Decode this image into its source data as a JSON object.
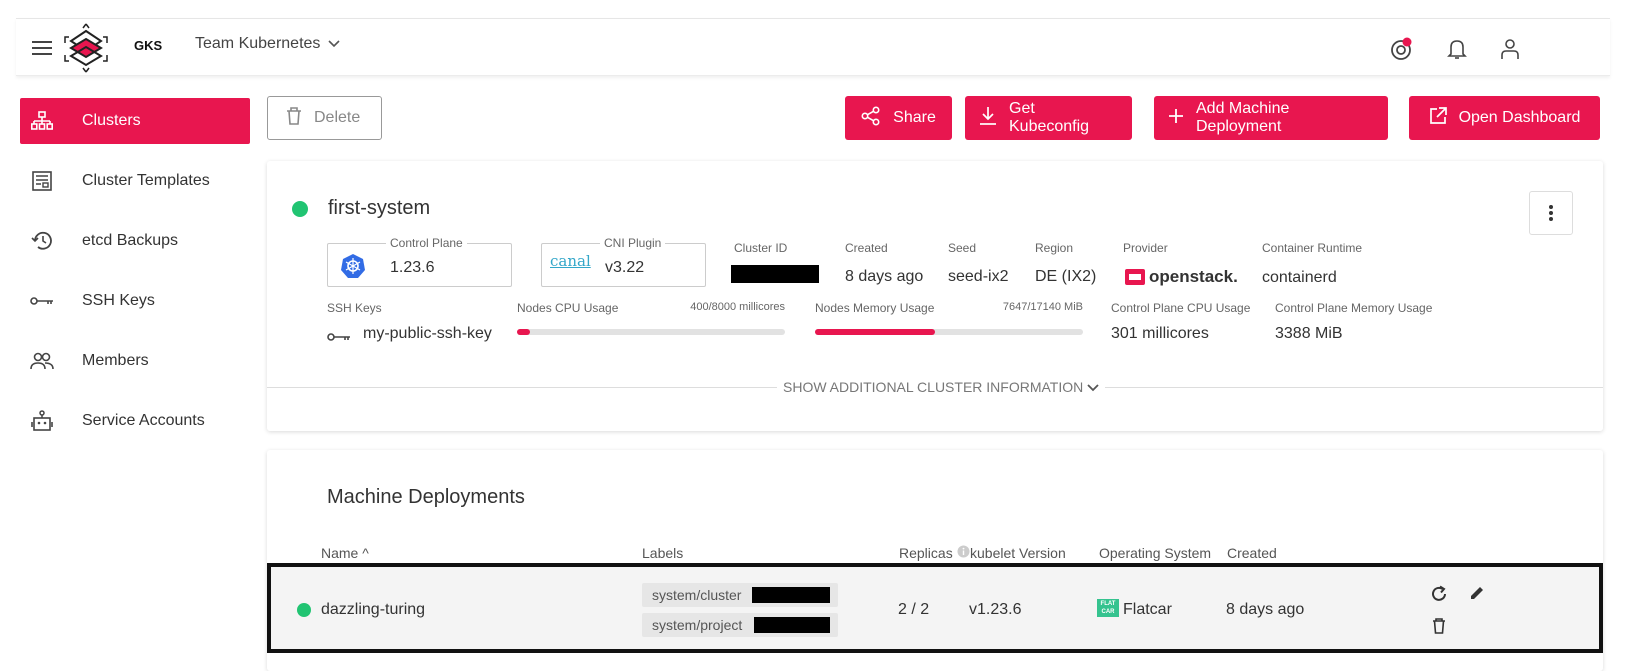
{
  "header": {
    "logo_text": "GKS",
    "team_name": "Team Kubernetes",
    "colors": {
      "accent": "#e8164f",
      "status_ok": "#21c472"
    }
  },
  "sidebar": {
    "items": [
      {
        "label": "Clusters",
        "icon": "cluster-icon",
        "active": true
      },
      {
        "label": "Cluster Templates",
        "icon": "template-icon",
        "active": false
      },
      {
        "label": "etcd Backups",
        "icon": "history-icon",
        "active": false
      },
      {
        "label": "SSH Keys",
        "icon": "key-icon",
        "active": false
      },
      {
        "label": "Members",
        "icon": "people-icon",
        "active": false
      },
      {
        "label": "Service Accounts",
        "icon": "robot-icon",
        "active": false
      }
    ]
  },
  "actions": {
    "delete_label": "Delete",
    "share_label": "Share",
    "kubeconfig_label": "Get Kubeconfig",
    "add_md_label": "Add Machine Deployment",
    "dashboard_label": "Open Dashboard"
  },
  "cluster": {
    "name": "first-system",
    "control_plane_legend": "Control Plane",
    "control_plane_version": "1.23.6",
    "cni_legend": "CNI Plugin",
    "cni_logo_text": "canal",
    "cni_version": "v3.22",
    "cluster_id_label": "Cluster ID",
    "created_label": "Created",
    "created_value": "8 days ago",
    "seed_label": "Seed",
    "seed_value": "seed-ix2",
    "region_label": "Region",
    "region_value": "DE (IX2)",
    "provider_label": "Provider",
    "provider_value": "openstack.",
    "runtime_label": "Container Runtime",
    "runtime_value": "containerd",
    "ssh_keys_label": "SSH Keys",
    "ssh_key_value": "my-public-ssh-key",
    "cpu_label": "Nodes CPU Usage",
    "cpu_value": "400/8000 millicores",
    "cpu_fraction": 0.05,
    "mem_label": "Nodes Memory Usage",
    "mem_value": "7647/17140 MiB",
    "mem_fraction": 0.446,
    "cp_cpu_label": "Control Plane CPU Usage",
    "cp_cpu_value": "301 millicores",
    "cp_mem_label": "Control Plane Memory Usage",
    "cp_mem_value": "3388 MiB",
    "show_more_label": "SHOW ADDITIONAL CLUSTER INFORMATION"
  },
  "machine_deployments": {
    "title": "Machine Deployments",
    "headers": {
      "name": "Name ^",
      "labels": "Labels",
      "replicas": "Replicas",
      "kubelet": "kubelet Version",
      "os": "Operating System",
      "created": "Created"
    },
    "rows": [
      {
        "name": "dazzling-turing",
        "labels": [
          "system/cluster",
          "system/project"
        ],
        "replicas": "2 / 2",
        "kubelet": "v1.23.6",
        "os_logo_text": "FLAT CAR",
        "os": "Flatcar",
        "created": "8 days ago"
      }
    ]
  }
}
